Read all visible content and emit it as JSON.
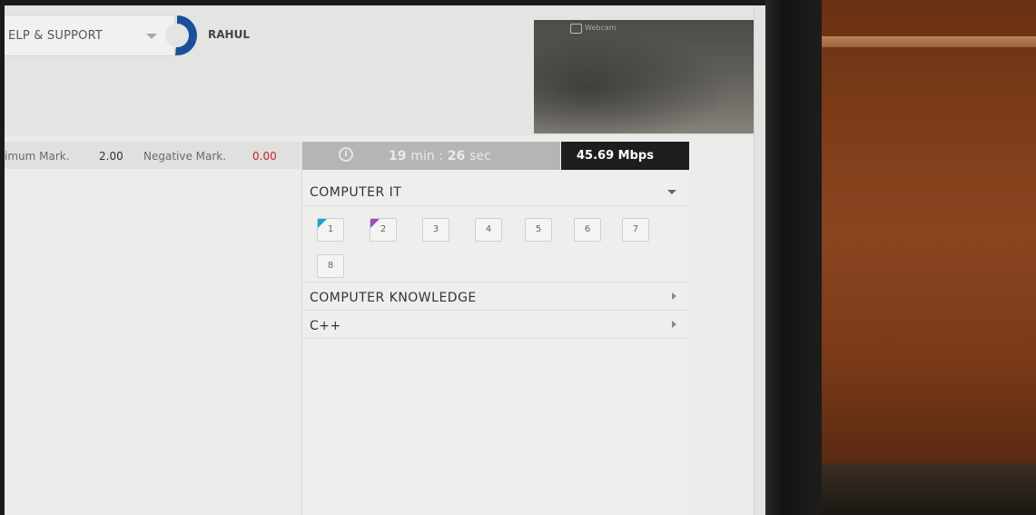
{
  "header": {
    "help_support_label": "ELP & SUPPORT",
    "user_name": "RAHUL",
    "webcam_label": "Webcam"
  },
  "marks": {
    "max_label": "imum Mark.",
    "max_value": "2.00",
    "negative_label": "Negative Mark.",
    "negative_value": "0.00"
  },
  "timer": {
    "minutes": "19",
    "min_unit": "min :",
    "seconds": "26",
    "sec_unit": "sec"
  },
  "network_speed": "45.69 Mbps",
  "sections": [
    {
      "title": "COMPUTER IT",
      "expanded": true,
      "questions": [
        {
          "label": "1",
          "status": "marked-blue"
        },
        {
          "label": "2",
          "status": "marked-purple"
        },
        {
          "label": "3",
          "status": "not-visited"
        },
        {
          "label": "4",
          "status": "not-visited"
        },
        {
          "label": "5",
          "status": "not-visited"
        },
        {
          "label": "6",
          "status": "not-visited"
        },
        {
          "label": "7",
          "status": "not-visited"
        },
        {
          "label": "8",
          "status": "not-visited"
        }
      ]
    },
    {
      "title": "COMPUTER KNOWLEDGE",
      "expanded": false
    },
    {
      "title": "C++",
      "expanded": false
    }
  ],
  "colors": {
    "negative_value": "#cc2222",
    "marked_blue": "#1aa3c9",
    "marked_purple": "#9a4fc0",
    "speed_bg": "#1e1e1e",
    "avatar_ring": "#1a4f9a"
  },
  "icons": [
    "chevron-down-icon",
    "alarm-clock-icon",
    "webcam-icon",
    "chevron-right-icon"
  ]
}
